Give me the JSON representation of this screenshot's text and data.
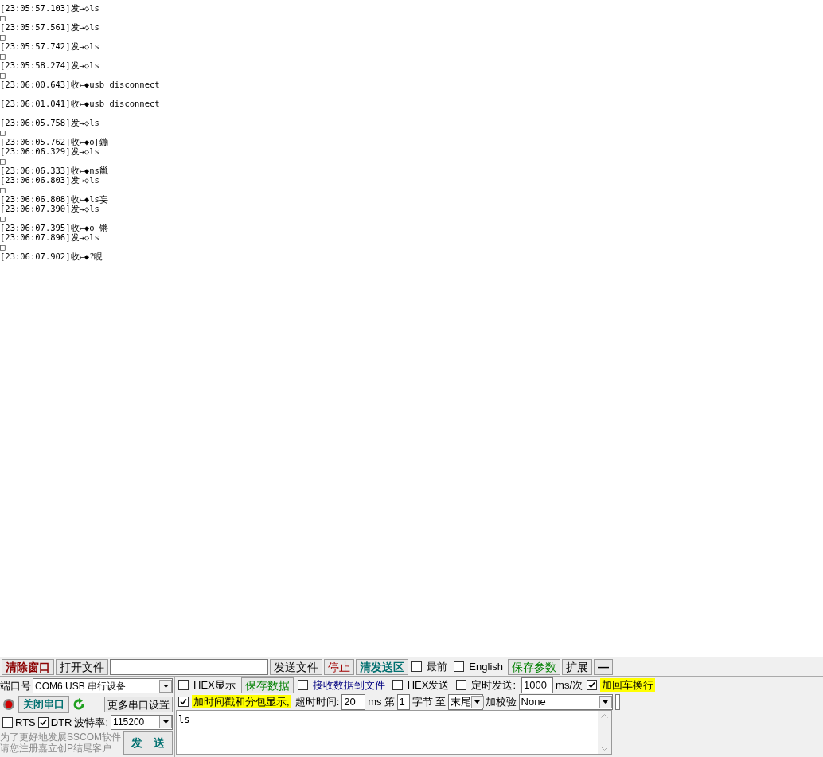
{
  "log_lines": [
    {
      "kind": "text",
      "text": "[23:05:57.103]发→◇ls"
    },
    {
      "kind": "text",
      "text": "□"
    },
    {
      "kind": "text",
      "text": "[23:05:57.561]发→◇ls"
    },
    {
      "kind": "text",
      "text": "□"
    },
    {
      "kind": "text",
      "text": "[23:05:57.742]发→◇ls"
    },
    {
      "kind": "text",
      "text": "□"
    },
    {
      "kind": "text",
      "text": "[23:05:58.274]发→◇ls"
    },
    {
      "kind": "text",
      "text": "□"
    },
    {
      "kind": "text",
      "text": "[23:06:00.643]收←◆usb disconnect"
    },
    {
      "kind": "blank"
    },
    {
      "kind": "text",
      "text": "[23:06:01.041]收←◆usb disconnect"
    },
    {
      "kind": "blank"
    },
    {
      "kind": "text",
      "text": "[23:06:05.758]发→◇ls"
    },
    {
      "kind": "text",
      "text": "□"
    },
    {
      "kind": "text",
      "text": "[23:06:05.762]收←◆o[鏰"
    },
    {
      "kind": "text",
      "text": "[23:06:06.329]发→◇ls"
    },
    {
      "kind": "text",
      "text": "□"
    },
    {
      "kind": "text",
      "text": "[23:06:06.333]收←◆ns巤"
    },
    {
      "kind": "text",
      "text": "[23:06:06.803]发→◇ls"
    },
    {
      "kind": "text",
      "text": "□"
    },
    {
      "kind": "text",
      "text": "[23:06:06.808]收←◆ls妄"
    },
    {
      "kind": "text",
      "text": "[23:06:07.390]发→◇ls"
    },
    {
      "kind": "text",
      "text": "□"
    },
    {
      "kind": "text",
      "text": "[23:06:07.395]收←◆o 锵"
    },
    {
      "kind": "text",
      "text": "[23:06:07.896]发→◇ls"
    },
    {
      "kind": "text",
      "text": "□"
    },
    {
      "kind": "text",
      "text": "[23:06:07.902]收←◆?睍"
    }
  ],
  "toolbar": [
    {
      "kind": "button",
      "label": "清除窗口",
      "color": "#8b0000",
      "bold": true
    },
    {
      "kind": "button",
      "label": "打开文件",
      "bold": false
    },
    {
      "kind": "field"
    },
    {
      "kind": "button",
      "label": "发送文件",
      "bold": false
    },
    {
      "kind": "button",
      "label": "停止",
      "color": "#a00000",
      "bold": false
    },
    {
      "kind": "button",
      "label": "清发送区",
      "color": "#007070",
      "bold": true
    },
    {
      "kind": "checkbox",
      "label": "最前",
      "checked": false,
      "highlight": false
    },
    {
      "kind": "checkbox",
      "label": "English",
      "checked": false,
      "highlight": false
    },
    {
      "kind": "button",
      "label": "保存参数",
      "color": "#008000",
      "bold": false
    },
    {
      "kind": "button",
      "label": "扩展",
      "bold": false
    },
    {
      "kind": "button",
      "label": "—",
      "bold": true
    }
  ],
  "port": {
    "label": "端口号",
    "value": "COM6 USB 串行设备"
  },
  "port_open": true,
  "close_port_button": "关闭串口",
  "more_settings_button": "更多串口设置",
  "rts": {
    "label": "RTS",
    "checked": false
  },
  "dtr": {
    "label": "DTR",
    "checked": true
  },
  "baud": {
    "label": "波特率:",
    "value": "115200"
  },
  "promo_text": [
    "为了更好地发展SSCOM软件",
    "请您注册嘉立创P结尾客户"
  ],
  "send_button": "发　送",
  "options_rows": [
    [
      {
        "kind": "checkbox",
        "label": "HEX显示",
        "checked": false,
        "highlight": false
      },
      {
        "kind": "button",
        "label": "保存数据",
        "color": "#008000",
        "bold": false
      },
      {
        "kind": "checkbox",
        "label": "接收数据到文件",
        "checked": false,
        "highlight": false,
        "color": "#000080"
      },
      {
        "kind": "checkbox",
        "label": "HEX发送",
        "checked": false,
        "highlight": false
      },
      {
        "kind": "checkbox",
        "label": "定时发送:",
        "checked": false,
        "highlight": false
      },
      {
        "kind": "field",
        "value": "1000"
      },
      {
        "kind": "label",
        "label": "ms/次"
      },
      {
        "kind": "checkbox",
        "label": "加回车换行",
        "checked": true,
        "highlight": true
      }
    ],
    [
      {
        "kind": "checkbox",
        "label": "加时间戳和分包显示,",
        "checked": true,
        "highlight": true
      },
      {
        "kind": "label",
        "label": "超时时间:"
      },
      {
        "kind": "field",
        "value": "20"
      },
      {
        "kind": "label",
        "label": "ms"
      },
      {
        "kind": "label",
        "label": "第"
      },
      {
        "kind": "field",
        "value": "1"
      },
      {
        "kind": "label",
        "label": "字节"
      },
      {
        "kind": "label",
        "label": "至"
      },
      {
        "kind": "select",
        "value": "末尾"
      },
      {
        "kind": "label",
        "label": "加校验"
      },
      {
        "kind": "select",
        "value": "None"
      },
      {
        "kind": "field"
      }
    ]
  ],
  "send_text": "ls"
}
